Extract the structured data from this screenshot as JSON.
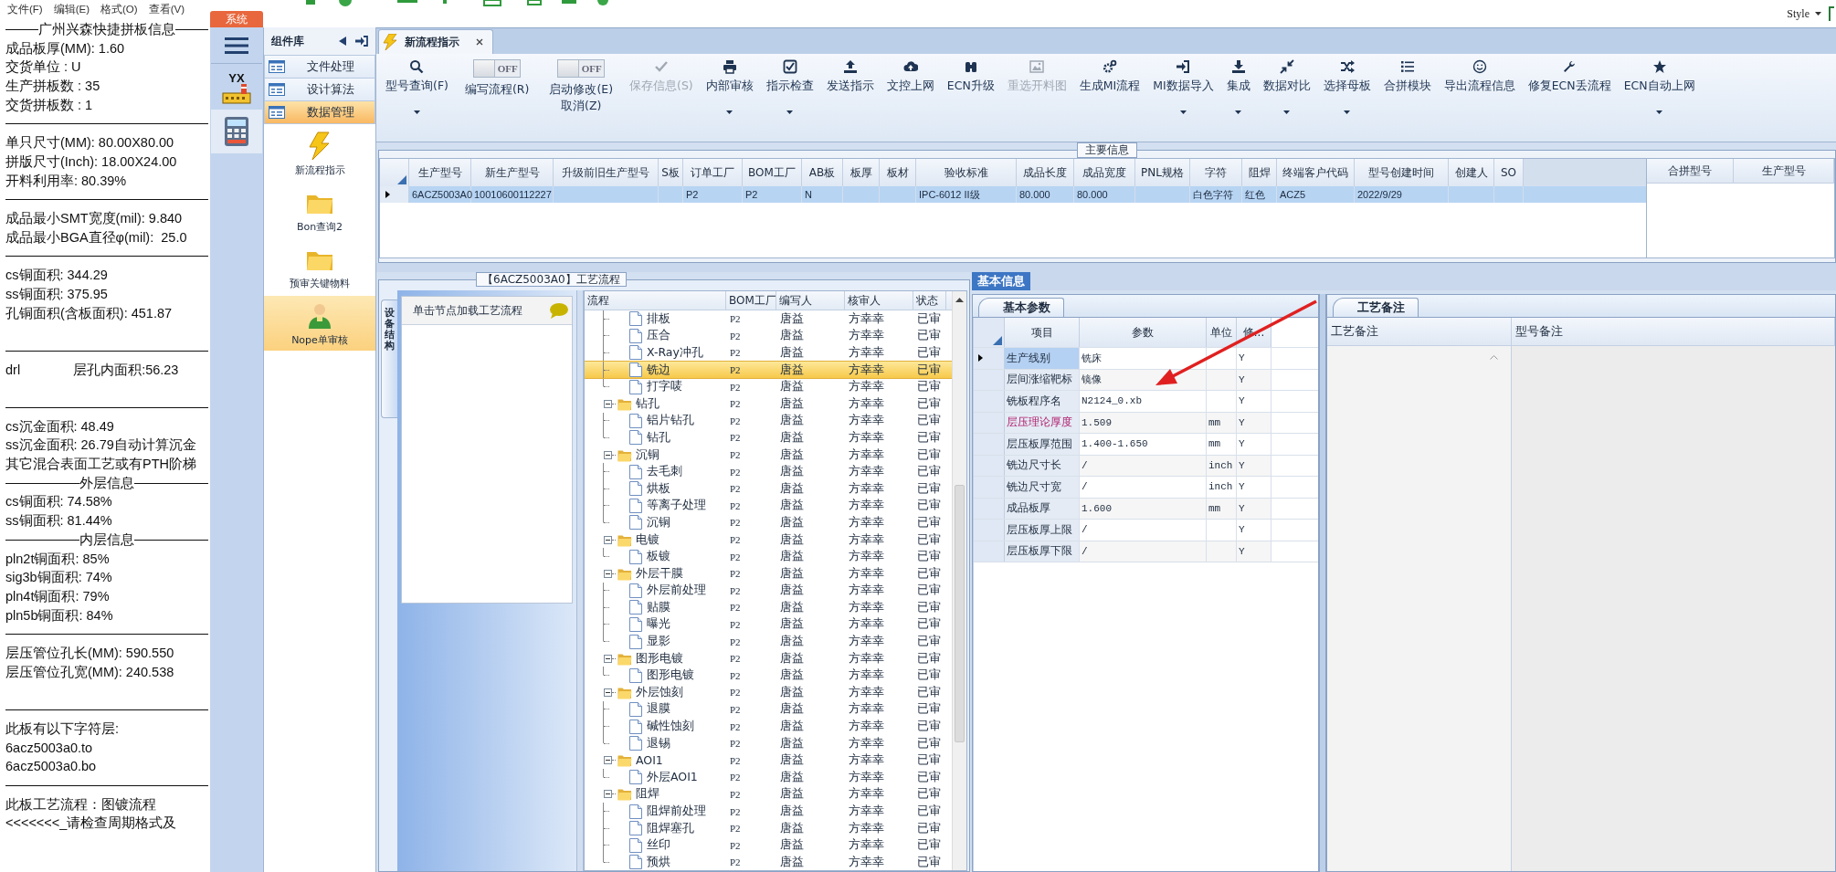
{
  "notepad": {
    "menu": [
      "文件(F)",
      "编辑(E)",
      "格式(O)",
      "查看(V)"
    ],
    "lines": [
      {
        "kind": "heading",
        "text": "广州兴森快捷拼板信息"
      },
      {
        "kind": "text",
        "text": "成品板厚(MM): 1.60"
      },
      {
        "kind": "text",
        "text": "交货单位 : U"
      },
      {
        "kind": "text",
        "text": "生产拼板数 : 35"
      },
      {
        "kind": "text",
        "text": "交货拼板数 : 1"
      },
      {
        "kind": "rule"
      },
      {
        "kind": "text",
        "text": "单只尺寸(MM): 80.00X80.00"
      },
      {
        "kind": "text",
        "text": "拼版尺寸(Inch): 18.00X24.00"
      },
      {
        "kind": "text",
        "text": "开料利用率: 80.39%"
      },
      {
        "kind": "rule"
      },
      {
        "kind": "text",
        "text": "成品最小SMT宽度(mil): 9.840"
      },
      {
        "kind": "text",
        "text": "成品最小BGA直径φ(mil):  25.0"
      },
      {
        "kind": "rule"
      },
      {
        "kind": "text",
        "text": "cs铜面积: 344.29"
      },
      {
        "kind": "text",
        "text": "ss铜面积: 375.95"
      },
      {
        "kind": "text",
        "text": "孔铜面积(含板面积): 451.87"
      },
      {
        "kind": "blank"
      },
      {
        "kind": "rule"
      },
      {
        "kind": "pair",
        "text": "drl",
        "text2": "层孔内面积:56.23"
      },
      {
        "kind": "blank"
      },
      {
        "kind": "rule"
      },
      {
        "kind": "text",
        "text": "cs沉金面积: 48.49"
      },
      {
        "kind": "text",
        "text": "ss沉金面积: 26.79自动计算沉金"
      },
      {
        "kind": "text",
        "text": "其它混合表面工艺或有PTH阶梯"
      },
      {
        "kind": "heading",
        "text": "外层信息"
      },
      {
        "kind": "text",
        "text": "cs铜面积: 74.58%"
      },
      {
        "kind": "text",
        "text": "ss铜面积: 81.44%"
      },
      {
        "kind": "heading",
        "text": "内层信息"
      },
      {
        "kind": "text",
        "text": "pln2t铜面积: 85%"
      },
      {
        "kind": "text",
        "text": "sig3b铜面积: 74%"
      },
      {
        "kind": "text",
        "text": "pln4t铜面积: 79%"
      },
      {
        "kind": "text",
        "text": "pln5b铜面积: 84%"
      },
      {
        "kind": "rule"
      },
      {
        "kind": "text",
        "text": "层压管位孔长(MM): 590.550"
      },
      {
        "kind": "text",
        "text": "层压管位孔宽(MM): 240.538"
      },
      {
        "kind": "blank"
      },
      {
        "kind": "rule"
      },
      {
        "kind": "text",
        "text": "此板有以下字符层:"
      },
      {
        "kind": "text",
        "text": "6acz5003a0.to"
      },
      {
        "kind": "text",
        "text": "6acz5003a0.bo"
      },
      {
        "kind": "rule"
      },
      {
        "kind": "text",
        "text": "此板工艺流程：图镀流程"
      },
      {
        "kind": "text",
        "text": "<<<<<<<_请检查周期格式及"
      }
    ]
  },
  "top_bar": {
    "system_tab": "系统",
    "style_menu": "Style",
    "app_badge": "YX"
  },
  "component_panel": {
    "title": "组件库",
    "categories": [
      {
        "label": "文件处理",
        "selected": false
      },
      {
        "label": "设计算法",
        "selected": false
      },
      {
        "label": "数据管理",
        "selected": true
      }
    ],
    "modules": [
      {
        "label": "新流程指示",
        "kind": "lightning",
        "selected": false
      },
      {
        "label": "Bon查询2",
        "kind": "folder",
        "selected": false
      },
      {
        "label": "预审关键物料",
        "kind": "folder",
        "selected": false
      },
      {
        "label": "Nope单审核",
        "kind": "person",
        "selected": true
      }
    ]
  },
  "document_tab": {
    "title": "新流程指示"
  },
  "toolbar": [
    {
      "kind": "button",
      "label": "型号查询(F)",
      "dropdown": true,
      "disabled": false
    },
    {
      "kind": "toggle",
      "label": "编写流程(R)",
      "state_text": "OFF",
      "on": false
    },
    {
      "kind": "toggle",
      "label": "启动修改(E)",
      "sublabel": "取消(Z)",
      "state_text": "OFF",
      "on": false
    },
    {
      "kind": "button",
      "label": "保存信息(S)",
      "dropdown": false,
      "disabled": true
    },
    {
      "kind": "button",
      "label": "内部审核",
      "dropdown": true,
      "disabled": false
    },
    {
      "kind": "button",
      "label": "指示检查",
      "dropdown": true,
      "disabled": false
    },
    {
      "kind": "button",
      "label": "发送指示",
      "dropdown": false,
      "disabled": false
    },
    {
      "kind": "button",
      "label": "文控上网",
      "dropdown": false,
      "disabled": false
    },
    {
      "kind": "button",
      "label": "ECN升级",
      "dropdown": false,
      "disabled": false
    },
    {
      "kind": "button",
      "label": "重选开料图",
      "dropdown": false,
      "disabled": true
    },
    {
      "kind": "button",
      "label": "生成MI流程",
      "dropdown": false,
      "disabled": false
    },
    {
      "kind": "button",
      "label": "MI数据导入",
      "dropdown": true,
      "disabled": false
    },
    {
      "kind": "button",
      "label": "集成",
      "dropdown": true,
      "disabled": false
    },
    {
      "kind": "button",
      "label": "数据对比",
      "dropdown": true,
      "disabled": false
    },
    {
      "kind": "button",
      "label": "选择母板",
      "dropdown": true,
      "disabled": false
    },
    {
      "kind": "button",
      "label": "合拼模块",
      "dropdown": false,
      "disabled": false
    },
    {
      "kind": "button",
      "label": "导出流程信息",
      "dropdown": false,
      "disabled": false
    },
    {
      "kind": "button",
      "label": "修复ECN丢流程",
      "dropdown": false,
      "disabled": false
    },
    {
      "kind": "button",
      "label": "ECN自动上网",
      "dropdown": true,
      "disabled": false
    }
  ],
  "main_info": {
    "title": "主要信息",
    "columns": [
      "生产型号",
      "新生产型号",
      "升级前旧生产型号",
      "S板",
      "订单工厂",
      "BOM工厂",
      "AB板",
      "板厚",
      "板材",
      "验收标准",
      "成品长度",
      "成品宽度",
      "PNL规格",
      "字符",
      "阻焊",
      "终端客户代码",
      "型号创建时间",
      "创建人",
      "SO"
    ],
    "rows": [
      {
        "selected": true,
        "cells": [
          "6ACZ5003A0",
          "10010600112227",
          null,
          null,
          "P2",
          "P2",
          "N",
          null,
          null,
          "IPC-6012 II级",
          "80.000",
          "80.000",
          null,
          "白色字符",
          "红色",
          "ACZ5",
          "2022/9/29",
          null,
          null
        ]
      }
    ],
    "side_columns": [
      "合拼型号",
      "生产型号"
    ]
  },
  "process_panel": {
    "title": "【6ACZ5003A0】工艺流程",
    "side_tab": "设备结构",
    "hint": "单击节点加载工艺流程",
    "tree": {
      "columns": [
        "流程",
        "BOM工厂",
        "编写人",
        "核审人",
        "状态"
      ],
      "continued": [
        {
          "name": "排板",
          "bom": "P2",
          "writer": "唐益",
          "reviewer": "方幸幸",
          "status": "已审",
          "selected": false
        },
        {
          "name": "压合",
          "bom": "P2",
          "writer": "唐益",
          "reviewer": "方幸幸",
          "status": "已审",
          "selected": false
        },
        {
          "name": "X-Ray冲孔",
          "bom": "P2",
          "writer": "唐益",
          "reviewer": "方幸幸",
          "status": "已审",
          "selected": false
        },
        {
          "name": "铣边",
          "bom": "P2",
          "writer": "唐益",
          "reviewer": "方幸幸",
          "status": "已审",
          "selected": true
        },
        {
          "name": "打字唛",
          "bom": "P2",
          "writer": "唐益",
          "reviewer": "方幸幸",
          "status": "已审",
          "selected": false
        }
      ],
      "nodes": [
        {
          "name": "钻孔",
          "bom": "P2",
          "writer": "唐益",
          "reviewer": "方幸幸",
          "status": "已审",
          "selected": false,
          "expanded": true,
          "children": [
            {
              "name": "铝片钻孔",
              "bom": "P2",
              "writer": "唐益",
              "reviewer": "方幸幸",
              "status": "已审",
              "selected": false
            },
            {
              "name": "钻孔",
              "bom": "P2",
              "writer": "唐益",
              "reviewer": "方幸幸",
              "status": "已审",
              "selected": false
            }
          ]
        },
        {
          "name": "沉铜",
          "bom": "P2",
          "writer": "唐益",
          "reviewer": "方幸幸",
          "status": "已审",
          "selected": false,
          "expanded": true,
          "children": [
            {
              "name": "去毛刺",
              "bom": "P2",
              "writer": "唐益",
              "reviewer": "方幸幸",
              "status": "已审",
              "selected": false
            },
            {
              "name": "烘板",
              "bom": "P2",
              "writer": "唐益",
              "reviewer": "方幸幸",
              "status": "已审",
              "selected": false
            },
            {
              "name": "等离子处理",
              "bom": "P2",
              "writer": "唐益",
              "reviewer": "方幸幸",
              "status": "已审",
              "selected": false
            },
            {
              "name": "沉铜",
              "bom": "P2",
              "writer": "唐益",
              "reviewer": "方幸幸",
              "status": "已审",
              "selected": false
            }
          ]
        },
        {
          "name": "电镀",
          "bom": "P2",
          "writer": "唐益",
          "reviewer": "方幸幸",
          "status": "已审",
          "selected": false,
          "expanded": true,
          "children": [
            {
              "name": "板镀",
              "bom": "P2",
              "writer": "唐益",
              "reviewer": "方幸幸",
              "status": "已审",
              "selected": false
            }
          ]
        },
        {
          "name": "外层干膜",
          "bom": "P2",
          "writer": "唐益",
          "reviewer": "方幸幸",
          "status": "已审",
          "selected": false,
          "expanded": true,
          "children": [
            {
              "name": "外层前处理",
              "bom": "P2",
              "writer": "唐益",
              "reviewer": "方幸幸",
              "status": "已审",
              "selected": false
            },
            {
              "name": "贴膜",
              "bom": "P2",
              "writer": "唐益",
              "reviewer": "方幸幸",
              "status": "已审",
              "selected": false
            },
            {
              "name": "曝光",
              "bom": "P2",
              "writer": "唐益",
              "reviewer": "方幸幸",
              "status": "已审",
              "selected": false
            },
            {
              "name": "显影",
              "bom": "P2",
              "writer": "唐益",
              "reviewer": "方幸幸",
              "status": "已审",
              "selected": false
            }
          ]
        },
        {
          "name": "图形电镀",
          "bom": "P2",
          "writer": "唐益",
          "reviewer": "方幸幸",
          "status": "已审",
          "selected": false,
          "expanded": true,
          "children": [
            {
              "name": "图形电镀",
              "bom": "P2",
              "writer": "唐益",
              "reviewer": "方幸幸",
              "status": "已审",
              "selected": false
            }
          ]
        },
        {
          "name": "外层蚀刻",
          "bom": "P2",
          "writer": "唐益",
          "reviewer": "方幸幸",
          "status": "已审",
          "selected": false,
          "expanded": true,
          "children": [
            {
              "name": "退膜",
              "bom": "P2",
              "writer": "唐益",
              "reviewer": "方幸幸",
              "status": "已审",
              "selected": false
            },
            {
              "name": "碱性蚀刻",
              "bom": "P2",
              "writer": "唐益",
              "reviewer": "方幸幸",
              "status": "已审",
              "selected": false
            },
            {
              "name": "退锡",
              "bom": "P2",
              "writer": "唐益",
              "reviewer": "方幸幸",
              "status": "已审",
              "selected": false
            }
          ]
        },
        {
          "name": "AOI1",
          "bom": "P2",
          "writer": "唐益",
          "reviewer": "方幸幸",
          "status": "已审",
          "selected": false,
          "expanded": true,
          "children": [
            {
              "name": "外层AOI1",
              "bom": "P2",
              "writer": "唐益",
              "reviewer": "方幸幸",
              "status": "已审",
              "selected": false
            }
          ]
        },
        {
          "name": "阻焊",
          "bom": "P2",
          "writer": "唐益",
          "reviewer": "方幸幸",
          "status": "已审",
          "selected": false,
          "expanded": true,
          "children": [
            {
              "name": "阻焊前处理",
              "bom": "P2",
              "writer": "唐益",
              "reviewer": "方幸幸",
              "status": "已审",
              "selected": false
            },
            {
              "name": "阻焊塞孔",
              "bom": "P2",
              "writer": "唐益",
              "reviewer": "方幸幸",
              "status": "已审",
              "selected": false
            },
            {
              "name": "丝印",
              "bom": "P2",
              "writer": "唐益",
              "reviewer": "方幸幸",
              "status": "已审",
              "selected": false
            },
            {
              "name": "预烘",
              "bom": "P2",
              "writer": "唐益",
              "reviewer": "方幸幸",
              "status": "已审",
              "selected": false
            }
          ]
        }
      ]
    }
  },
  "basic_info": {
    "tab": "基本信息",
    "params": {
      "tab": "基本参数",
      "columns": [
        "项目",
        "参数",
        "单位",
        "修..."
      ],
      "rows": [
        {
          "item": "生产线别",
          "value": "铣床",
          "unit": null,
          "flag": "Y",
          "selected": true,
          "flagged": false
        },
        {
          "item": "层间涨缩靶标",
          "value": "镜像",
          "unit": null,
          "flag": "Y",
          "selected": false,
          "flagged": false
        },
        {
          "item": "铣板程序名",
          "value": "N2124_0.xb",
          "unit": null,
          "flag": "Y",
          "selected": false,
          "flagged": false
        },
        {
          "item": "层压理论厚度",
          "value": "1.509",
          "unit": "mm",
          "flag": "Y",
          "selected": false,
          "flagged": true
        },
        {
          "item": "层压板厚范围",
          "value": "1.400-1.650",
          "unit": "mm",
          "flag": "Y",
          "selected": false,
          "flagged": false
        },
        {
          "item": "铣边尺寸长",
          "value": "/",
          "unit": "inch",
          "flag": "Y",
          "selected": false,
          "flagged": false
        },
        {
          "item": "铣边尺寸宽",
          "value": "/",
          "unit": "inch",
          "flag": "Y",
          "selected": false,
          "flagged": false
        },
        {
          "item": "成品板厚",
          "value": "1.600",
          "unit": "mm",
          "flag": "Y",
          "selected": false,
          "flagged": false
        },
        {
          "item": "层压板厚上限",
          "value": "/",
          "unit": null,
          "flag": "Y",
          "selected": false,
          "flagged": false
        },
        {
          "item": "层压板厚下限",
          "value": "/",
          "unit": null,
          "flag": "Y",
          "selected": false,
          "flagged": false
        }
      ]
    },
    "notes": {
      "tab": "工艺备注",
      "columns": [
        "工艺备注",
        "型号备注"
      ]
    }
  }
}
